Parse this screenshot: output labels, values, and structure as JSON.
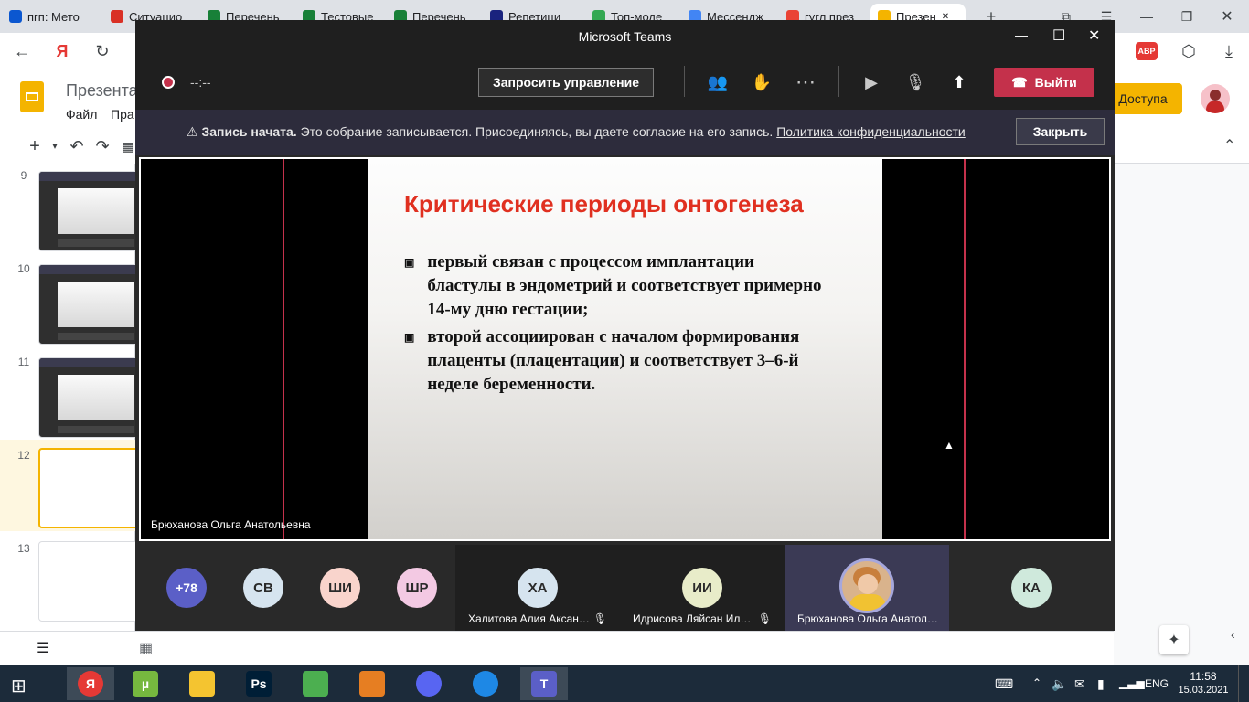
{
  "browser": {
    "tabs": [
      {
        "label": "пгп: Мето",
        "color": "#0b57d0",
        "icon": "tutor-icon"
      },
      {
        "label": "Ситуацио",
        "color": "#d93025",
        "icon": "doc-icon"
      },
      {
        "label": "Перечень",
        "color": "#188038",
        "icon": "drive-icon"
      },
      {
        "label": "Тестовые",
        "color": "#188038",
        "icon": "drive-icon"
      },
      {
        "label": "Перечень",
        "color": "#188038",
        "icon": "drive-icon"
      },
      {
        "label": "Репетици",
        "color": "#1a237e",
        "icon": "star-icon"
      },
      {
        "label": "Топ-моде",
        "color": "#34a853",
        "icon": "hd-icon"
      },
      {
        "label": "Мессендж",
        "color": "#4285f4",
        "icon": "msg-icon"
      },
      {
        "label": "гугл през",
        "color": "#ea4335",
        "icon": "yandex-icon"
      },
      {
        "label": "Презен",
        "color": "#f4b400",
        "icon": "slides-icon",
        "active": true
      }
    ],
    "new_tab": "+",
    "abp_badge": "ABP"
  },
  "slides_app": {
    "doc_title": "Презента",
    "menu": [
      "Файл",
      "Пра"
    ],
    "share_button": "Доступа",
    "slide_numbers": [
      "9",
      "10",
      "11",
      "12",
      "13"
    ]
  },
  "teams": {
    "window_title": "Microsoft Teams",
    "timer": "--:--",
    "request_control": "Запросить управление",
    "leave_button": "Выйти",
    "banner": {
      "bold": "Запись начата.",
      "text": "Это собрание записывается. Присоединяясь, вы даете согласие на его запись.",
      "link": "Политика конфиденциальности",
      "close": "Закрыть"
    },
    "presenter_name": "Брюханова Ольга Анатольевна",
    "slide": {
      "title": "Критические периоды онтогенеза",
      "bullets": [
        "первый связан с процессом имплантации бластулы в эндометрий и соответствует примерно 14-му дню гестации;",
        "второй ассоциирован с началом формирования плаценты (плацентации) и соответствует 3–6-й неделе беременности."
      ]
    },
    "gallery": {
      "avatars": [
        {
          "initials": "+78",
          "color": "#5b5fc7"
        },
        {
          "initials": "СВ",
          "color": "#d6e4ef"
        },
        {
          "initials": "ШИ",
          "color": "#f9d4cc"
        },
        {
          "initials": "ШР",
          "color": "#f3c9e3"
        }
      ],
      "tiles": [
        {
          "initials": "ХА",
          "name": "Халитова Алия Аксан…",
          "color": "#d6e4ef"
        },
        {
          "initials": "ИИ",
          "name": "Идрисова Ляйсан Ил…",
          "color": "#e8ecc9"
        },
        {
          "initials": "",
          "name": "Брюханова Ольга Анатол…",
          "color": "#f1c232"
        },
        {
          "initials": "КА",
          "name": "",
          "color": "#cfe9dc"
        }
      ]
    }
  },
  "taskbar": {
    "lang": "ENG",
    "time": "11:58",
    "date": "15.03.2021",
    "apps": [
      {
        "icon": "yandex-browser-icon",
        "label": "Я",
        "color": "#e53935"
      },
      {
        "icon": "utorrent-icon",
        "label": "µ",
        "color": "#76b83f"
      },
      {
        "icon": "file-explorer-icon",
        "label": "",
        "color": "#f4c430"
      },
      {
        "icon": "photoshop-icon",
        "label": "Ps",
        "color": "#001e36"
      },
      {
        "icon": "maps-icon",
        "label": "",
        "color": "#4caf50"
      },
      {
        "icon": "pencil-icon",
        "label": "",
        "color": "#e67e22"
      },
      {
        "icon": "discord-icon",
        "label": "",
        "color": "#5865f2"
      },
      {
        "icon": "network-icon",
        "label": "",
        "color": "#1e88e5"
      },
      {
        "icon": "teams-icon",
        "label": "T",
        "color": "#5b5fc7"
      }
    ]
  }
}
